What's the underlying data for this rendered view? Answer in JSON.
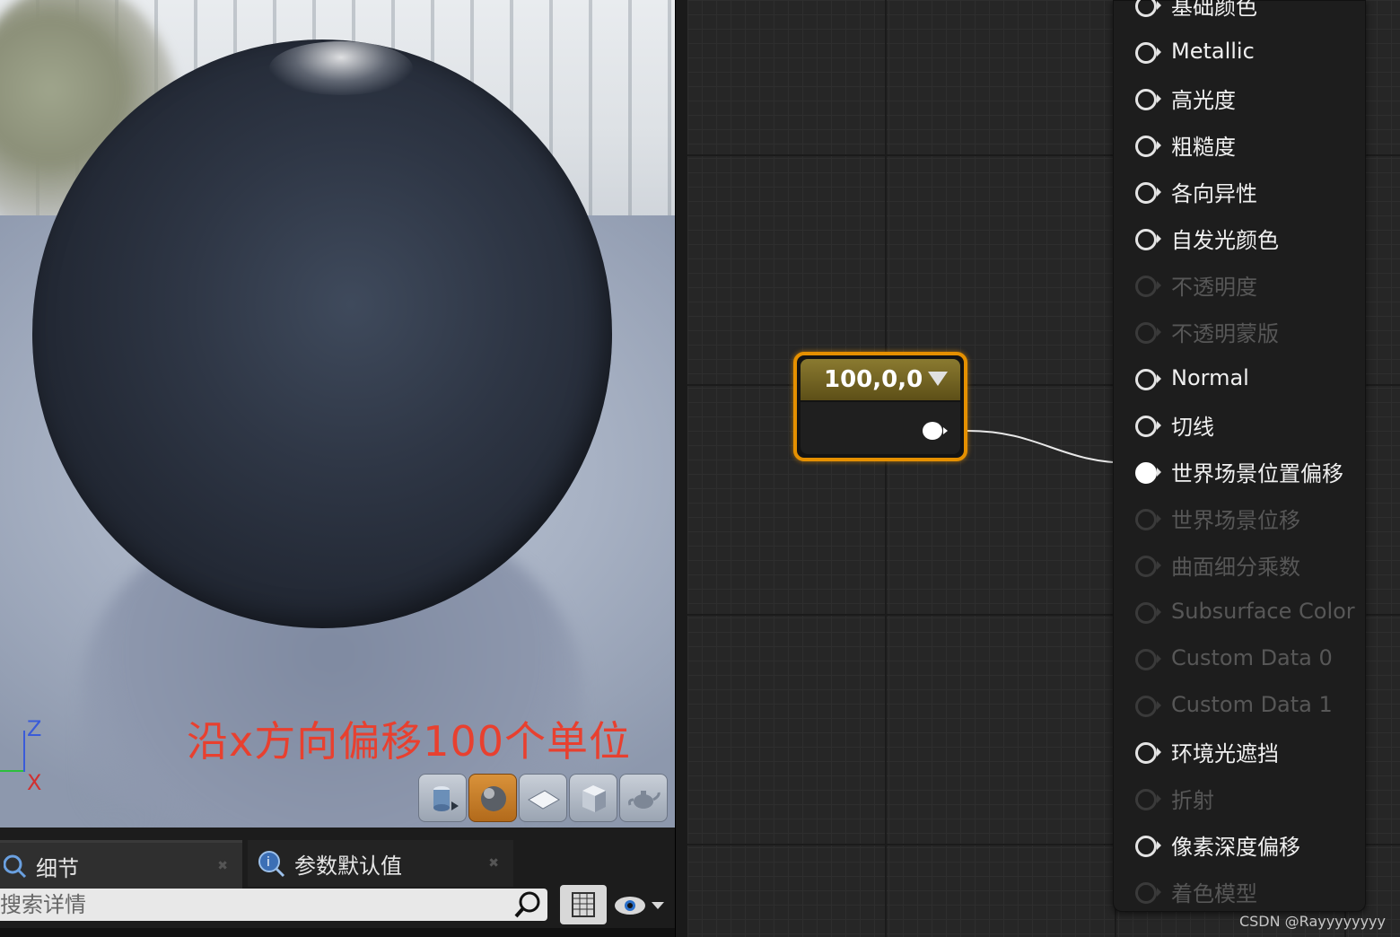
{
  "viewport": {
    "annotation": "沿x方向偏移100个单位",
    "axis": {
      "z_label": "Z",
      "x_label": "X"
    },
    "toolbar": [
      {
        "name": "cylinder",
        "active": false
      },
      {
        "name": "sphere",
        "active": true
      },
      {
        "name": "plane",
        "active": false
      },
      {
        "name": "cube",
        "active": false
      },
      {
        "name": "teapot",
        "active": false
      }
    ]
  },
  "details_panel": {
    "tabs": [
      {
        "label": "细节"
      },
      {
        "label": "参数默认值"
      }
    ],
    "search": {
      "placeholder": "搜索详情",
      "value": ""
    }
  },
  "graph": {
    "constant_node": {
      "value": "100,0,0"
    },
    "material_node": {
      "top_partial_label": "基础颜色",
      "pins": [
        {
          "label": "Metallic",
          "enabled": true,
          "connected": false
        },
        {
          "label": "高光度",
          "enabled": true,
          "connected": false
        },
        {
          "label": "粗糙度",
          "enabled": true,
          "connected": false
        },
        {
          "label": "各向异性",
          "enabled": true,
          "connected": false
        },
        {
          "label": "自发光颜色",
          "enabled": true,
          "connected": false
        },
        {
          "label": "不透明度",
          "enabled": false,
          "connected": false
        },
        {
          "label": "不透明蒙版",
          "enabled": false,
          "connected": false
        },
        {
          "label": "Normal",
          "enabled": true,
          "connected": false
        },
        {
          "label": "切线",
          "enabled": true,
          "connected": false
        },
        {
          "label": "世界场景位置偏移",
          "enabled": true,
          "connected": true
        },
        {
          "label": "世界场景位移",
          "enabled": false,
          "connected": false
        },
        {
          "label": "曲面细分乘数",
          "enabled": false,
          "connected": false
        },
        {
          "label": "Subsurface Color",
          "enabled": false,
          "connected": false
        },
        {
          "label": "Custom Data 0",
          "enabled": false,
          "connected": false
        },
        {
          "label": "Custom Data 1",
          "enabled": false,
          "connected": false
        },
        {
          "label": "环境光遮挡",
          "enabled": true,
          "connected": false
        },
        {
          "label": "折射",
          "enabled": false,
          "connected": false
        },
        {
          "label": "像素深度偏移",
          "enabled": true,
          "connected": false
        },
        {
          "label": "着色模型",
          "enabled": false,
          "connected": false
        }
      ]
    }
  },
  "watermark": "CSDN @Rayyyyyyyy",
  "colors": {
    "annotation": "#e8402f",
    "node_border": "#e59000",
    "graph_bg": "#262626"
  }
}
